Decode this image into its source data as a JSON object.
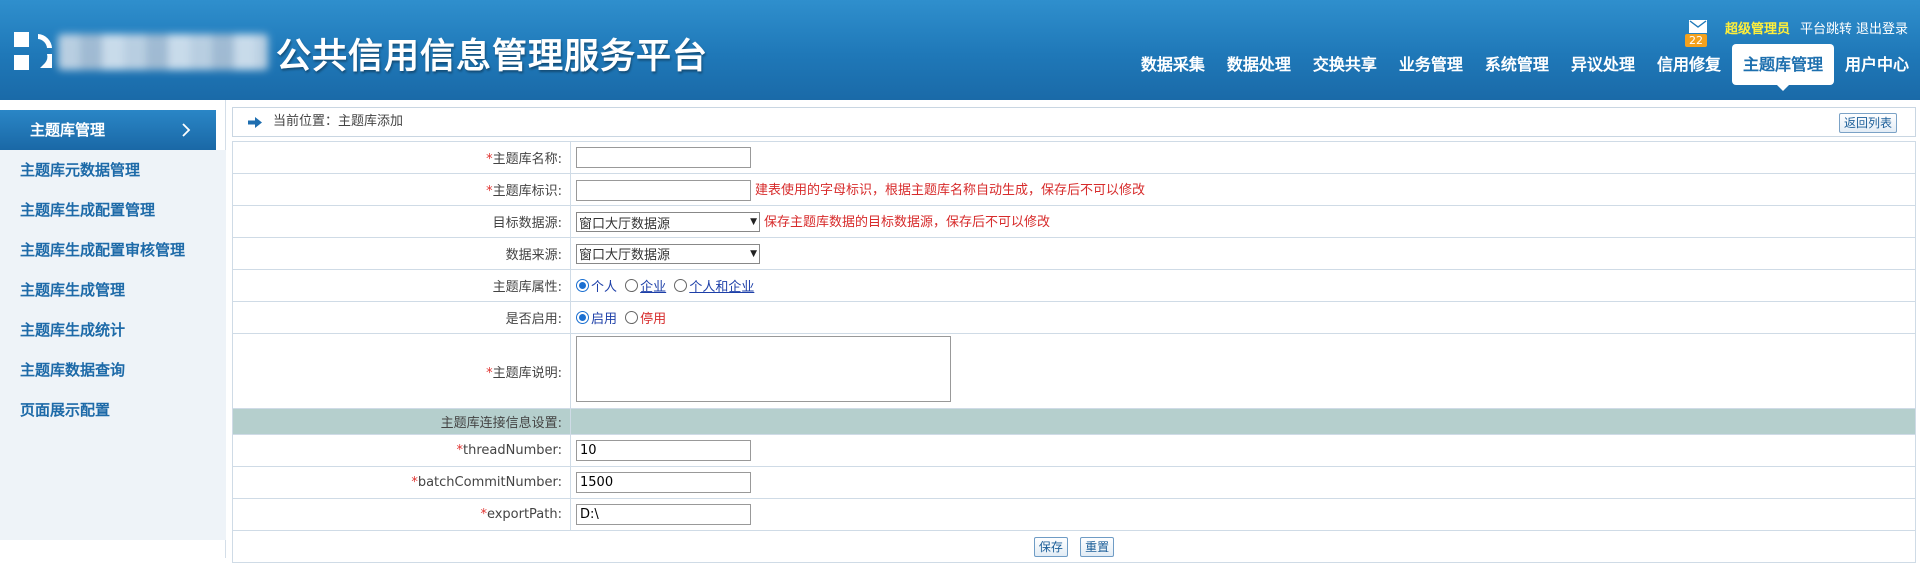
{
  "header": {
    "title": "公共信用信息管理服务平台",
    "mail_badge": "22",
    "username": "超级管理员",
    "platform_jump": "平台跳转",
    "logout": "退出登录"
  },
  "nav": [
    {
      "label": "数据采集"
    },
    {
      "label": "数据处理"
    },
    {
      "label": "交换共享"
    },
    {
      "label": "业务管理"
    },
    {
      "label": "系统管理"
    },
    {
      "label": "异议处理"
    },
    {
      "label": "信用修复"
    },
    {
      "label": "主题库管理",
      "active": true
    },
    {
      "label": "用户中心"
    }
  ],
  "sidebar": {
    "heading": "主题库管理",
    "items": [
      {
        "label": "主题库元数据管理"
      },
      {
        "label": "主题库生成配置管理"
      },
      {
        "label": "主题库生成配置审核管理"
      },
      {
        "label": "主题库生成管理"
      },
      {
        "label": "主题库生成统计"
      },
      {
        "label": "主题库数据查询"
      },
      {
        "label": "页面展示配置"
      }
    ]
  },
  "breadcrumb": {
    "text": "当前位置：主题库添加",
    "back_button": "返回列表"
  },
  "form": {
    "name_label": "主题库名称:",
    "name_value": "",
    "code_label": "主题库标识:",
    "code_value": "",
    "code_hint": "建表使用的字母标识，根据主题库名称自动生成，保存后不可以修改",
    "target_label": "目标数据源:",
    "target_value": "窗口大厅数据源",
    "target_hint": "保存主题库数据的目标数据源，保存后不可以修改",
    "source_label": "数据来源:",
    "source_value": "窗口大厅数据源",
    "attr_label": "主题库属性:",
    "attr_options": [
      "个人",
      "企业",
      "个人和企业"
    ],
    "enabled_label": "是否启用:",
    "enabled_options": [
      "启用",
      "停用"
    ],
    "desc_label": "主题库说明:",
    "desc_value": "",
    "section_label": "主题库连接信息设置:",
    "thread_label": "threadNumber:",
    "thread_value": "10",
    "batch_label": "batchCommitNumber:",
    "batch_value": "1500",
    "export_label": "exportPath:",
    "export_value": "D:\\",
    "save_button": "保存",
    "reset_button": "重置"
  },
  "colors": {
    "header_blue": "#1f78b8",
    "nav_active_text": "#1d6fae",
    "username_yellow": "#ffef3a",
    "hint_red": "#d72b2b",
    "section_bg": "#b5cfcd",
    "sidebar_bg": "#eef3f8"
  }
}
